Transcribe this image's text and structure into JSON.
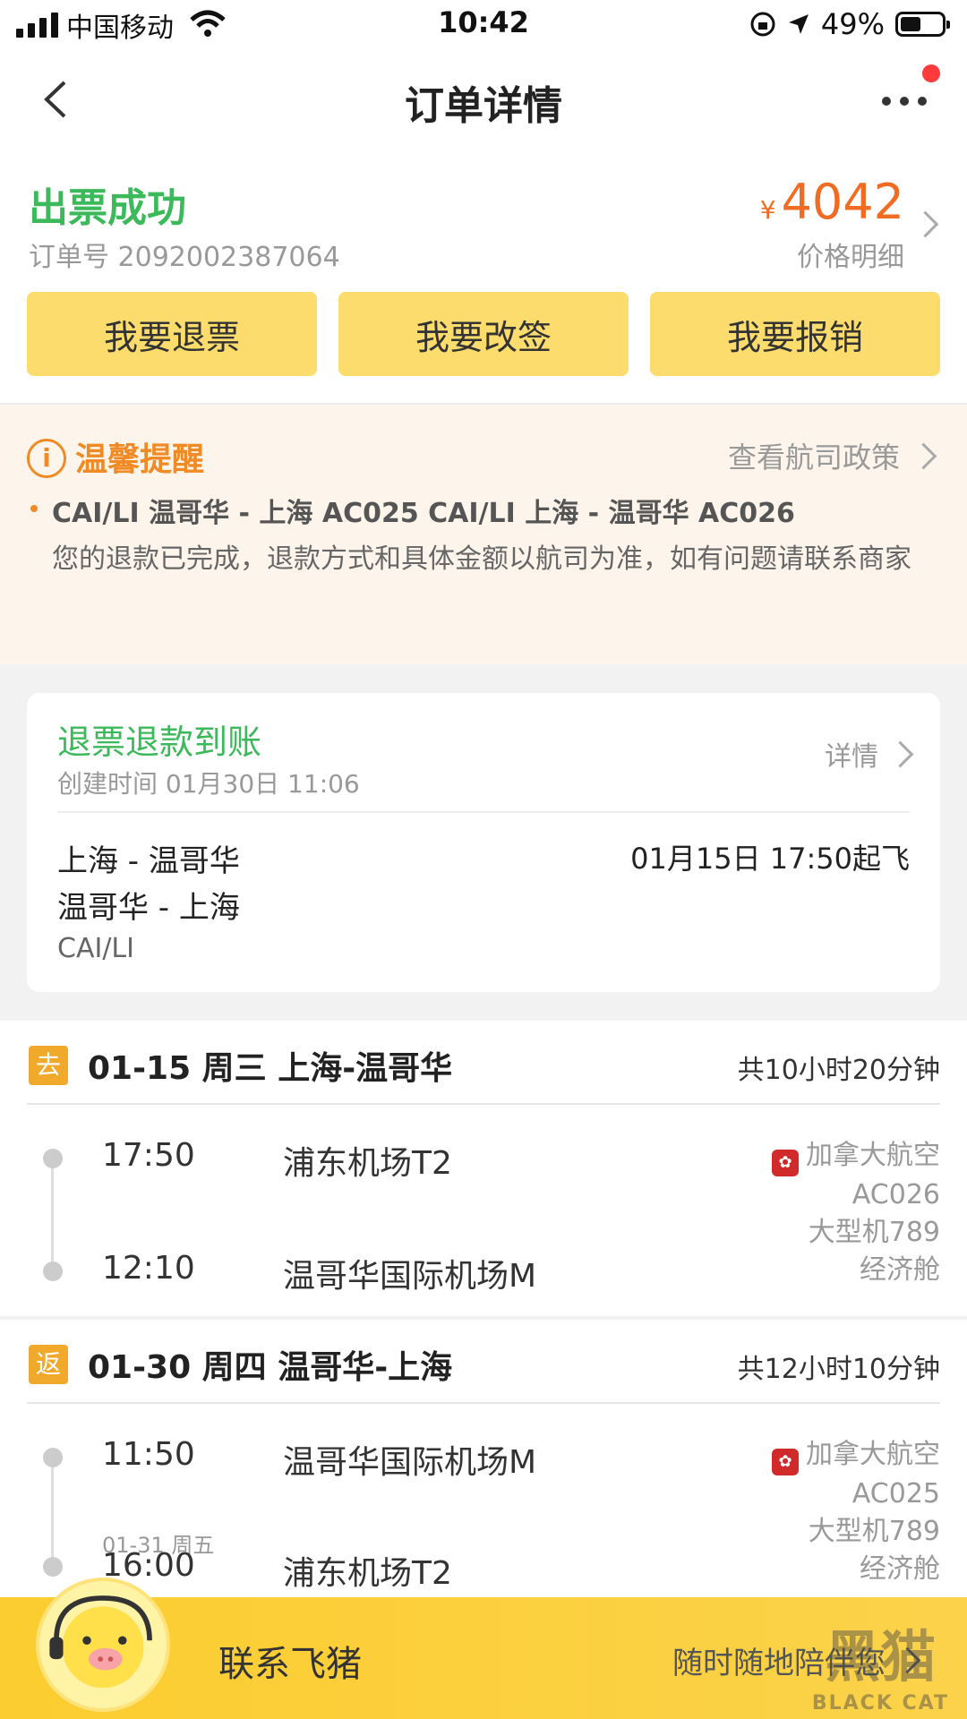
{
  "status_bar": {
    "carrier": "中国移动",
    "time": "10:42",
    "battery": "49%"
  },
  "nav": {
    "title": "订单详情"
  },
  "summary": {
    "status": "出票成功",
    "order_number": "订单号 2092002387064",
    "currency": "¥",
    "price": "4042",
    "price_detail": "价格明细",
    "buttons": [
      "我要退票",
      "我要改签",
      "我要报销"
    ]
  },
  "notice": {
    "title": "温馨提醒",
    "policy_link": "查看航司政策",
    "flights_line": "CAI/LI 温哥华 - 上海 AC025 CAI/LI 上海 - 温哥华 AC026",
    "message": "您的退款已完成，退款方式和具体金额以航司为准，如有问题请联系商家"
  },
  "refund": {
    "title": "退票退款到账",
    "created": "创建时间 01月30日 11:06",
    "detail_link": "详情",
    "route_1": "上海 - 温哥华",
    "route_2": "温哥华 - 上海",
    "passenger": "CAI/LI",
    "departure": "01月15日 17:50起飞"
  },
  "segments": [
    {
      "tag": "去",
      "header": "01-15 周三 上海-温哥华",
      "duration": "共10小时20分钟",
      "dep_time": "17:50",
      "dep_airport": "浦东机场T2",
      "arr_time": "12:10",
      "arr_airport": "温哥华国际机场M",
      "airline": "加拿大航空",
      "flight_no": "AC026",
      "aircraft": "大型机789",
      "cabin": "经济舱"
    },
    {
      "tag": "返",
      "header": "01-30 周四 温哥华-上海",
      "duration": "共12小时10分钟",
      "dep_time": "11:50",
      "dep_airport": "温哥华国际机场M",
      "arr_date": "01-31 周五",
      "arr_time": "16:00",
      "arr_airport": "浦东机场T2",
      "airline": "加拿大航空",
      "flight_no": "AC025",
      "aircraft": "大型机789",
      "cabin": "经济舱"
    }
  ],
  "bottom": {
    "contact": "联系飞猪",
    "slogan": "随时随地陪伴您"
  },
  "watermark": {
    "cn": "黑猫",
    "en": "BLACK CAT"
  },
  "colors": {
    "success": "#3cb95a",
    "price": "#f26b22",
    "button": "#fbdc6c",
    "notice": "#f08a24",
    "brand_bar": "#fccd30"
  }
}
